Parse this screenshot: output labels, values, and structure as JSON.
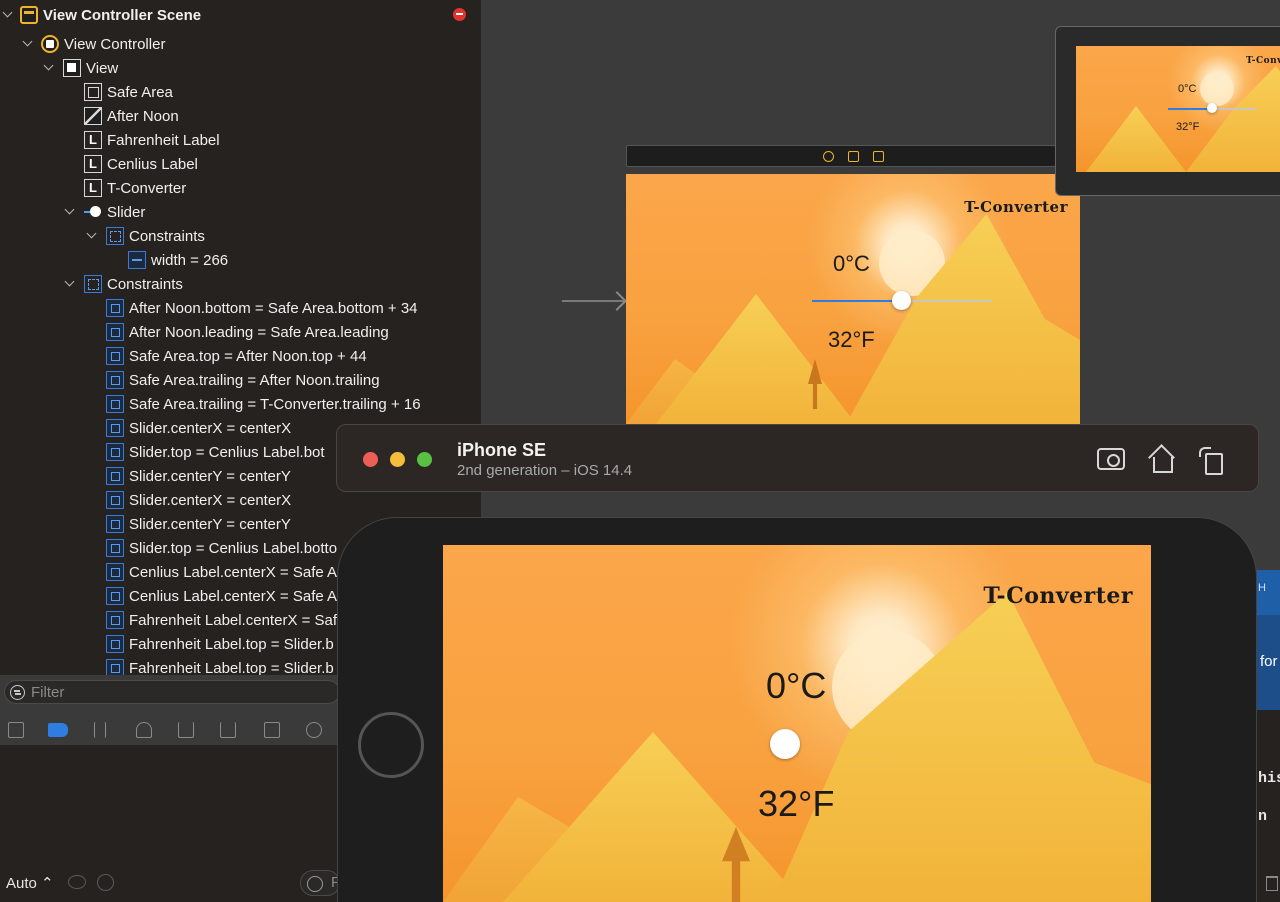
{
  "outline": {
    "scene": "View Controller Scene",
    "view_controller": "View Controller",
    "view": "View",
    "subviews": [
      "Safe Area",
      "After Noon",
      "Fahrenheit Label",
      "Cenlius Label",
      "T-Converter"
    ],
    "label_icon_glyph": "L",
    "slider": "Slider",
    "slider_constraints": "Constraints",
    "slider_width": "width = 266",
    "constraints": "Constraints",
    "constraint_items": [
      "After Noon.bottom = Safe Area.bottom + 34",
      "After Noon.leading = Safe Area.leading",
      "Safe Area.top = After Noon.top + 44",
      "Safe Area.trailing = After Noon.trailing",
      "Safe Area.trailing = T-Converter.trailing + 16",
      "Slider.centerX = centerX",
      "Slider.top = Cenlius Label.bot",
      "Slider.centerY = centerY",
      "Slider.centerX = centerX",
      "Slider.centerY = centerY",
      "Slider.top = Cenlius Label.botto",
      "Cenlius Label.centerX = Safe A",
      "Cenlius Label.centerX = Safe A",
      "Fahrenheit Label.centerX = Saf",
      "Fahrenheit Label.top = Slider.b",
      "Fahrenheit Label.top = Slider.b"
    ]
  },
  "filter": {
    "placeholder": "Filter"
  },
  "debug": {
    "auto_label": "Auto ⌃",
    "console_filter": "F"
  },
  "app": {
    "title": "T-Converter",
    "celsius": "0°C",
    "fahrenheit": "32°F",
    "slider_value_fraction": 0.5
  },
  "simulator": {
    "device_name": "iPhone SE",
    "subtitle": "2nd generation – iOS 14.4"
  },
  "peek": {
    "right_text_1": "for",
    "right_text_2": "his",
    "right_text_3": "n",
    "right_icon": "H"
  },
  "colors": {
    "accent_blue": "#2f7de1",
    "scene_gold": "#f0b429",
    "badge_red": "#e2322f",
    "sky_orange": "#fba64a"
  }
}
